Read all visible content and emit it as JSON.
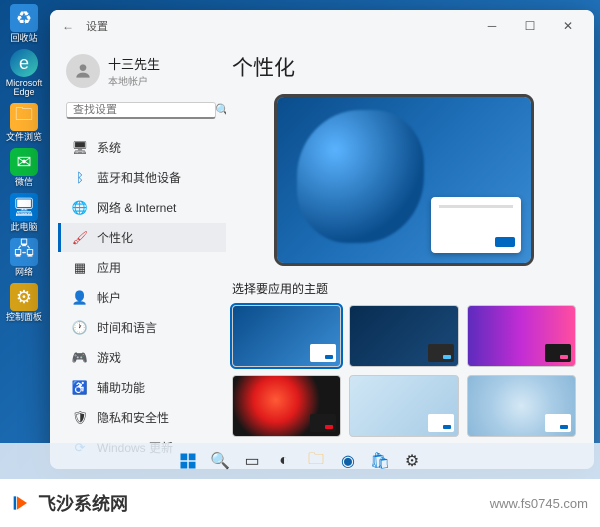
{
  "desktop": {
    "icons": [
      {
        "label": "回收站",
        "icon": "recycle-icon"
      },
      {
        "label": "Microsoft Edge",
        "icon": "edge-icon"
      },
      {
        "label": "文件浏览",
        "icon": "folder-icon"
      },
      {
        "label": "微信",
        "icon": "wechat-icon"
      },
      {
        "label": "此电脑",
        "icon": "pc-icon"
      },
      {
        "label": "网络",
        "icon": "network-icon"
      },
      {
        "label": "控制面板",
        "icon": "control-panel-icon"
      }
    ]
  },
  "window": {
    "title": "设置"
  },
  "user": {
    "name": "十三先生",
    "type": "本地帐户"
  },
  "search": {
    "placeholder": "查找设置"
  },
  "sidebar": {
    "items": [
      {
        "icon": "system-icon",
        "label": "系统"
      },
      {
        "icon": "bluetooth-icon",
        "label": "蓝牙和其他设备"
      },
      {
        "icon": "network-icon",
        "label": "网络 & Internet"
      },
      {
        "icon": "personalization-icon",
        "label": "个性化",
        "active": true
      },
      {
        "icon": "apps-icon",
        "label": "应用"
      },
      {
        "icon": "accounts-icon",
        "label": "帐户"
      },
      {
        "icon": "time-language-icon",
        "label": "时间和语言"
      },
      {
        "icon": "gaming-icon",
        "label": "游戏"
      },
      {
        "icon": "accessibility-icon",
        "label": "辅助功能"
      },
      {
        "icon": "privacy-icon",
        "label": "隐私和安全性"
      },
      {
        "icon": "update-icon",
        "label": "Windows 更新"
      }
    ]
  },
  "main": {
    "title": "个性化",
    "themes_heading": "选择要应用的主题",
    "themes": [
      {
        "name": "windows-light",
        "selected": true
      },
      {
        "name": "windows-dark"
      },
      {
        "name": "glow"
      },
      {
        "name": "captured-motion"
      },
      {
        "name": "sunrise"
      },
      {
        "name": "flow"
      }
    ]
  },
  "watermark": {
    "text": "飞沙系统网",
    "url": "www.fs0745.com"
  }
}
